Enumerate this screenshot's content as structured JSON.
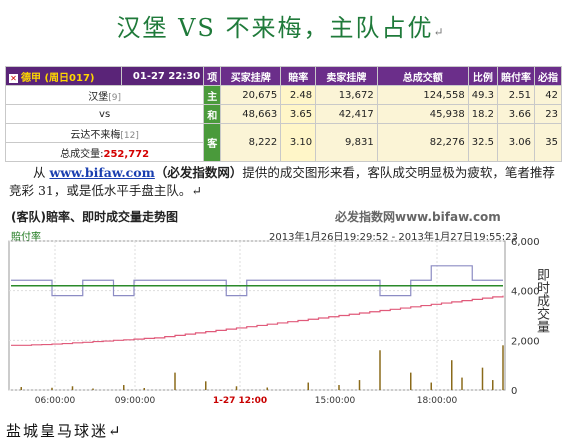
{
  "title": "汉堡 VS 不来梅，主队占优",
  "para_mark": "↵",
  "odds_table": {
    "match_label": "德甲 (周日017)",
    "time": "01-27 22:30",
    "headers": [
      "项",
      "买家挂牌",
      "賠率",
      "卖家挂牌",
      "总成交额",
      "比例",
      "賠付率",
      "必指"
    ],
    "home_team": "汉堡",
    "home_rank": "[9]",
    "vs": "vs",
    "away_team": "云达不来梅",
    "away_rank": "[12]",
    "volume_label": "总成交量:",
    "volume_value": "252,772",
    "rows": [
      {
        "side": "主",
        "buy": "20,675",
        "odds": "2.48",
        "sell": "13,672",
        "total": "124,558",
        "ratio": "49.3",
        "payout": "2.51",
        "index": "42"
      },
      {
        "side": "和",
        "buy": "48,663",
        "odds": "3.65",
        "sell": "42,417",
        "total": "45,938",
        "ratio": "18.2",
        "payout": "3.66",
        "index": "23"
      },
      {
        "side": "客",
        "buy": "8,222",
        "odds": "3.10",
        "sell": "9,831",
        "total": "82,276",
        "ratio": "32.5",
        "payout": "3.06",
        "index": "35"
      }
    ]
  },
  "paragraph": {
    "pre": "从 ",
    "link": "www.bifaw.com",
    "bold": "（必发指数网）",
    "post": "提供的成交图形来看，客队成交明显极为疲软，笔者推荐竞彩 31，或是低水平手盘主队。↵"
  },
  "chart": {
    "title": "(客队)賠率、即时成交量走势图",
    "site": "必发指数网www.bifaw.com",
    "range": "2013年1月26日19:29:52 - 2013年1月27日19:55:23",
    "series_label": "賠付率",
    "y_label": "即时成交量",
    "x_ticks": [
      "06:00:00",
      "09:00:00",
      "1-27 12:00",
      "15:00:00",
      "18:00:00"
    ],
    "y_ticks": [
      "6,000",
      "4,000",
      "2,000",
      "0"
    ],
    "colors": {
      "odds": "#8c8cc4",
      "green": "#2a8a2a",
      "pink": "#e05a7a",
      "bars": "#8a6a1a",
      "highlight": "#c80000"
    }
  },
  "chart_data": {
    "type": "line",
    "title": "(客队)賠率、即时成交量走势图",
    "ylabel": "即时成交量",
    "ylim": [
      0,
      6000
    ],
    "x_ticks": [
      "06:00:00",
      "09:00:00",
      "1-27 12:00",
      "15:00:00",
      "18:00:00"
    ],
    "series": [
      {
        "name": "賠付率",
        "values": [
          4420,
          4420,
          4420,
          4420,
          3800,
          3800,
          3800,
          4420,
          4420,
          4420,
          3800,
          3800,
          4420,
          4420,
          4420,
          4420,
          4420,
          4420,
          4420,
          4420,
          4420,
          3800,
          3800,
          4420,
          4420,
          4420,
          4420,
          4420,
          4420,
          4420,
          4420,
          4420,
          4420,
          4420,
          4420,
          4420,
          3800,
          3800,
          3800,
          4420,
          4420,
          5000,
          5000,
          5000,
          5000,
          4420,
          4420,
          4420,
          4420
        ]
      },
      {
        "values": [
          4200,
          4200,
          4200,
          4200,
          4200,
          4200,
          4200,
          4200,
          4200,
          4200,
          4200,
          4200,
          4200,
          4200,
          4200,
          4200,
          4200,
          4200,
          4200,
          4200,
          4200,
          4200,
          4200,
          4200,
          4200,
          4200,
          4200,
          4200,
          4200,
          4200,
          4200,
          4200,
          4200,
          4200,
          4200,
          4200,
          4200,
          4200,
          4200,
          4200,
          4200,
          4200,
          4200,
          4200,
          4200,
          4200,
          4200,
          4200,
          4200
        ]
      },
      {
        "values": [
          1800,
          1800,
          1820,
          1830,
          1850,
          1870,
          1900,
          1920,
          1950,
          1970,
          2000,
          2020,
          2050,
          2080,
          2100,
          2150,
          2200,
          2250,
          2300,
          2350,
          2400,
          2450,
          2500,
          2550,
          2600,
          2650,
          2700,
          2750,
          2800,
          2850,
          2900,
          2950,
          3000,
          3050,
          3100,
          3150,
          3200,
          3250,
          3300,
          3350,
          3400,
          3450,
          3500,
          3550,
          3600,
          3650,
          3700,
          3750,
          3800
        ]
      }
    ],
    "bars": [
      0,
      120,
      0,
      0,
      90,
      0,
      150,
      0,
      60,
      0,
      0,
      200,
      0,
      80,
      0,
      0,
      700,
      0,
      0,
      350,
      0,
      0,
      150,
      0,
      0,
      100,
      0,
      0,
      0,
      300,
      0,
      0,
      200,
      0,
      400,
      0,
      1600,
      0,
      0,
      700,
      0,
      300,
      0,
      1200,
      500,
      0,
      900,
      400,
      1800
    ]
  },
  "footer": "盐城皇马球迷↵"
}
